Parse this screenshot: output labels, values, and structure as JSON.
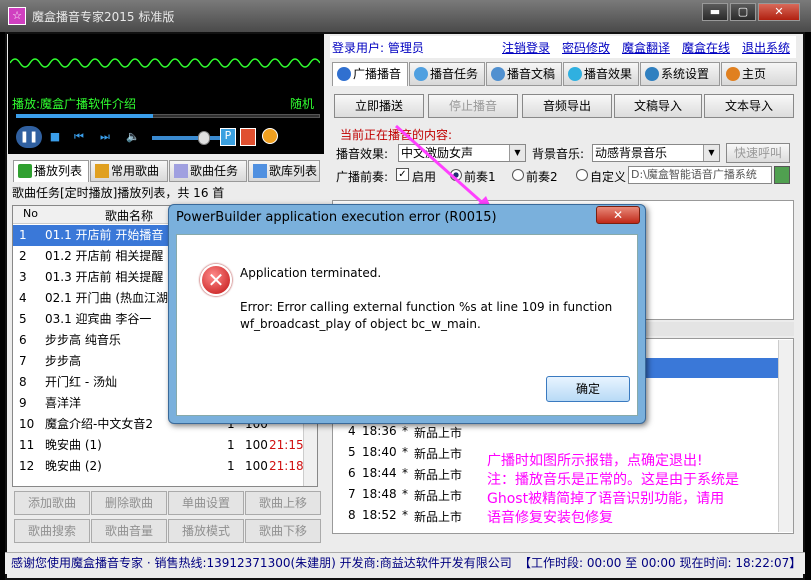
{
  "window": {
    "title": "魔盒播音专家2015 标准版",
    "min": "▬",
    "max": "▢",
    "close": "✕",
    "app_icon": "☆"
  },
  "player": {
    "now_playing": "播放:魔盒广播软件介绍",
    "mode": "随机",
    "progress": 0.45,
    "volume": 0.7,
    "controls": [
      "pause",
      "stop",
      "prev",
      "next",
      "volume"
    ]
  },
  "left_tabs": [
    "播放列表",
    "常用歌曲",
    "歌曲任务",
    "歌库列表"
  ],
  "task_label": "歌曲任务[定时播放]播放列表，共 16 首",
  "list_header": {
    "no": "No",
    "name": "歌曲名称"
  },
  "songs": [
    {
      "no": "1",
      "name": "01.1 开店前 开始播音",
      "c": "",
      "v": "",
      "t": ""
    },
    {
      "no": "2",
      "name": "01.2 开店前 相关提醒",
      "c": "",
      "v": "",
      "t": ""
    },
    {
      "no": "3",
      "name": "01.3 开店前 相关提醒",
      "c": "",
      "v": "",
      "t": ""
    },
    {
      "no": "4",
      "name": "02.1 开门曲 (热血江湖",
      "c": "",
      "v": "",
      "t": ""
    },
    {
      "no": "5",
      "name": "03.1 迎宾曲 李谷一",
      "c": "",
      "v": "",
      "t": ""
    },
    {
      "no": "6",
      "name": "步步高 纯音乐",
      "c": "",
      "v": "",
      "t": ""
    },
    {
      "no": "7",
      "name": "步步高",
      "c": "",
      "v": "",
      "t": ""
    },
    {
      "no": "8",
      "name": "开门红 - 汤灿",
      "c": "",
      "v": "",
      "t": ""
    },
    {
      "no": "9",
      "name": "喜洋洋",
      "c": "",
      "v": "",
      "t": ""
    },
    {
      "no": "10",
      "name": "魔盒介绍-中文女音2",
      "c": "1",
      "v": "100",
      "t": ""
    },
    {
      "no": "11",
      "name": "晚安曲 (1)",
      "c": "1",
      "v": "100",
      "t": "21:15"
    },
    {
      "no": "12",
      "name": "晚安曲 (2)",
      "c": "1",
      "v": "100",
      "t": "21:18"
    }
  ],
  "left_buttons": [
    "添加歌曲",
    "删除歌曲",
    "单曲设置",
    "歌曲上移",
    "歌曲搜索",
    "歌曲音量",
    "播放模式",
    "歌曲下移"
  ],
  "login": {
    "label": "登录用户: 管理员",
    "links": [
      "注销登录",
      "密码修改",
      "魔盒翻译",
      "魔盒在线",
      "退出系统"
    ]
  },
  "right_tabs": [
    "广播播音",
    "播音任务",
    "播音文稿",
    "播音效果",
    "系统设置",
    "主页"
  ],
  "action_buttons": [
    "立即播送",
    "停止播音",
    "音频导出",
    "文稿导入",
    "文本导入"
  ],
  "current_label": "当前正在播音的内容:",
  "effect": {
    "label": "播音效果:",
    "value": "中文激励女声"
  },
  "bgm": {
    "label": "背景音乐:",
    "value": "动感背景音乐"
  },
  "quick_call": "快速呼叫",
  "prelude": {
    "label": "广播前奏:",
    "enable": "启用",
    "opt1": "前奏1",
    "opt2": "前奏2",
    "custom": "自定义",
    "path": "D:\\魔盒智能语音广播系统"
  },
  "times": [
    {
      "no": "4",
      "time": "18:36",
      "star": "*",
      "text": "新品上市"
    },
    {
      "no": "5",
      "time": "18:40",
      "star": "*",
      "text": "新品上市"
    },
    {
      "no": "6",
      "time": "18:44",
      "star": "*",
      "text": "新品上市"
    },
    {
      "no": "7",
      "time": "18:48",
      "star": "*",
      "text": "新品上市"
    },
    {
      "no": "8",
      "time": "18:52",
      "star": "*",
      "text": "新品上市"
    }
  ],
  "status": {
    "left": "感谢您使用魔盒播音专家 · 销售热线:13912371300(朱建朋) 开发商:商益达软件开发有限公司",
    "right": "【工作时段: 00:00 至 00:00 现在时间: 18:22:07】"
  },
  "dialog": {
    "title": "PowerBuilder application execution error (R0015)",
    "close": "✕",
    "icon": "✕",
    "line1": "Application terminated.",
    "line2": "Error: Error calling external function %s at line 109 in function",
    "line3": "wf_broadcast_play of object bc_w_main.",
    "ok": "确定"
  },
  "note": [
    "广播时如图所示报错，点确定退出!",
    "注：播放音乐是正常的。这是由于系统是",
    "Ghost被精简掉了语音识别功能，请用",
    "语音修复安装包修复"
  ],
  "colors": {
    "accent": "#3a78d8",
    "note": "#ff00ff",
    "green": "#30ff30"
  }
}
